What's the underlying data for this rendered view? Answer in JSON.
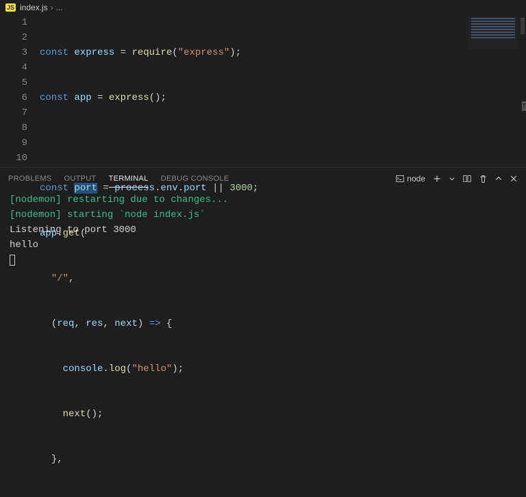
{
  "breadcrumb": {
    "fileBadge": "JS",
    "fileName": "index.js",
    "tail": "..."
  },
  "editor": {
    "lineNumbers": [
      "1",
      "2",
      "3",
      "4",
      "5",
      "6",
      "7",
      "8",
      "9",
      "10"
    ],
    "lines": {
      "l1": {
        "kw": "const",
        "id": "express",
        "eq": " = ",
        "fn": "require",
        "paren": "(",
        "str": "\"express\"",
        "close": ");"
      },
      "l2": {
        "kw": "const",
        "id": "app",
        "eq": " = ",
        "fn": "express",
        "call": "();"
      },
      "l3": {
        "blank": ""
      },
      "l4": {
        "kw": "const",
        "sel": "port",
        "eq": " = ",
        "obj": "process",
        "dot1": ".",
        "env": "env",
        "dot2": ".",
        "prop": "port",
        "or": " || ",
        "num": "3000",
        "semi": ";"
      },
      "l5": {
        "recv": "app",
        "dot": ".",
        "fn": "get",
        "open": "("
      },
      "l6": {
        "indent": "  ",
        "str": "\"/\"",
        "comma": ","
      },
      "l7": {
        "indent": "  ",
        "open": "(",
        "p1": "req",
        "c1": ", ",
        "p2": "res",
        "c2": ", ",
        "p3": "next",
        "close": ") ",
        "arrow": "=>",
        "brace": " {"
      },
      "l8": {
        "indent": "    ",
        "obj": "console",
        "dot": ".",
        "fn": "log",
        "open": "(",
        "str": "\"hello\"",
        "close": ");"
      },
      "l9": {
        "indent": "    ",
        "fn": "next",
        "call": "();"
      },
      "l10": {
        "indent": "  ",
        "close": "},"
      }
    }
  },
  "panel": {
    "tabs": {
      "problems": "PROBLEMS",
      "output": "OUTPUT",
      "terminal": "TERMINAL",
      "debug": "DEBUG CONSOLE"
    },
    "shellLabel": "node"
  },
  "terminal": {
    "line1": "[nodemon] restarting due to changes...",
    "line2": "[nodemon] starting `node index.js`",
    "line3": "Listening to port 3000",
    "line4": "hello"
  }
}
